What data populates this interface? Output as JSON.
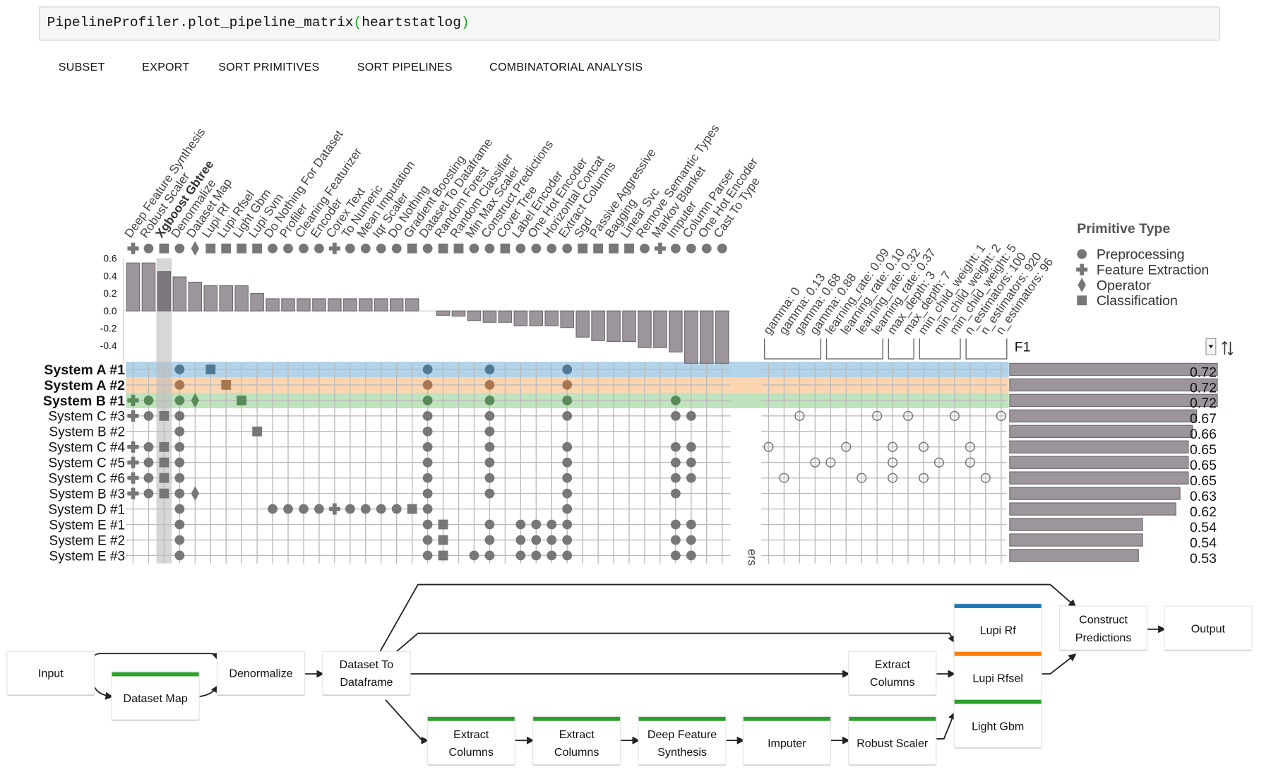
{
  "code_cell": {
    "prefix": "PipelineProfiler.plot_pipeline_matrix",
    "open": "(",
    "arg": "heartstatlog",
    "close": ")"
  },
  "menu": [
    "SUBSET",
    "EXPORT",
    "SORT PRIMITIVES",
    "SORT PIPELINES",
    "COMBINATORIAL ANALYSIS"
  ],
  "colors": {
    "preprocessing_icon": "#777777",
    "bar_fill": "#9c969c",
    "highlight_blue": "#b3d3e8",
    "highlight_orange": "#fdd5b1",
    "highlight_green": "#bfe3bd",
    "node_blue": "#1f77b4",
    "node_orange": "#ff7f0e",
    "node_green": "#2ca02c"
  },
  "legend": {
    "title": "Primitive Type",
    "items": [
      {
        "type": "preprocessing",
        "label": "Preprocessing"
      },
      {
        "type": "feature",
        "label": "Feature Extraction"
      },
      {
        "type": "operator",
        "label": "Operator"
      },
      {
        "type": "classification",
        "label": "Classification"
      }
    ]
  },
  "importance_axis": {
    "ticks": [
      "0.6",
      "0.4",
      "0.2",
      "0.0",
      "-0.2",
      "-0.4"
    ],
    "tick_values": [
      0.6,
      0.4,
      0.2,
      0.0,
      -0.2,
      -0.4
    ],
    "range": [
      -0.6,
      0.6
    ]
  },
  "highlighted_primitive": 2,
  "primitives": [
    {
      "name": "Deep Feature Synthesis",
      "type": "feature",
      "importance": 0.55
    },
    {
      "name": "Robust Scaler",
      "type": "preprocessing",
      "importance": 0.55
    },
    {
      "name": "Xgboost Gbtree",
      "type": "classification",
      "importance": 0.45,
      "bold": true
    },
    {
      "name": "Denormalize",
      "type": "preprocessing",
      "importance": 0.39
    },
    {
      "name": "Dataset Map",
      "type": "operator",
      "importance": 0.33
    },
    {
      "name": "Lupi Rf",
      "type": "classification",
      "importance": 0.29
    },
    {
      "name": "Lupi Rfsel",
      "type": "classification",
      "importance": 0.29
    },
    {
      "name": "Light Gbm",
      "type": "classification",
      "importance": 0.29
    },
    {
      "name": "Lupi Svm",
      "type": "classification",
      "importance": 0.2
    },
    {
      "name": "Do Nothing For Dataset",
      "type": "preprocessing",
      "importance": 0.14
    },
    {
      "name": "Profiler",
      "type": "preprocessing",
      "importance": 0.14
    },
    {
      "name": "Cleaning Featurizer",
      "type": "preprocessing",
      "importance": 0.14
    },
    {
      "name": "Encoder",
      "type": "preprocessing",
      "importance": 0.14
    },
    {
      "name": "Corex Text",
      "type": "feature",
      "importance": 0.14
    },
    {
      "name": "To Numeric",
      "type": "preprocessing",
      "importance": 0.14
    },
    {
      "name": "Mean Imputation",
      "type": "preprocessing",
      "importance": 0.14
    },
    {
      "name": "Iqr Scaler",
      "type": "preprocessing",
      "importance": 0.14
    },
    {
      "name": "Do Nothing",
      "type": "preprocessing",
      "importance": 0.14
    },
    {
      "name": "Gradient Boosting",
      "type": "classification",
      "importance": 0.14
    },
    {
      "name": "Dataset To Dataframe",
      "type": "preprocessing",
      "importance": 0.0
    },
    {
      "name": "Random Forest",
      "type": "classification",
      "importance": -0.05
    },
    {
      "name": "Random Classifier",
      "type": "classification",
      "importance": -0.06
    },
    {
      "name": "Min Max Scaler",
      "type": "preprocessing",
      "importance": -0.11
    },
    {
      "name": "Construct Predictions",
      "type": "preprocessing",
      "importance": -0.13
    },
    {
      "name": "Cover Tree",
      "type": "classification",
      "importance": -0.13
    },
    {
      "name": "Label Encoder",
      "type": "preprocessing",
      "importance": -0.17
    },
    {
      "name": "One Hot Encoder",
      "type": "preprocessing",
      "importance": -0.17
    },
    {
      "name": "Horizontal Concat",
      "type": "preprocessing",
      "importance": -0.17
    },
    {
      "name": "Extract Columns",
      "type": "preprocessing",
      "importance": -0.19
    },
    {
      "name": "Sgd",
      "type": "classification",
      "importance": -0.3
    },
    {
      "name": "Passive Aggressive",
      "type": "classification",
      "importance": -0.34
    },
    {
      "name": "Bagging",
      "type": "classification",
      "importance": -0.35
    },
    {
      "name": "Linear Svc",
      "type": "classification",
      "importance": -0.35
    },
    {
      "name": "Remove Semantic Types",
      "type": "preprocessing",
      "importance": -0.42
    },
    {
      "name": "Markov Blanket",
      "type": "feature",
      "importance": -0.42
    },
    {
      "name": "Imputer",
      "type": "preprocessing",
      "importance": -0.47
    },
    {
      "name": "Column Parser",
      "type": "preprocessing",
      "importance": -0.6
    },
    {
      "name": "One Hot Encoder",
      "type": "preprocessing",
      "importance": -0.6
    },
    {
      "name": "Cast To Type",
      "type": "preprocessing",
      "importance": -0.6
    }
  ],
  "hyperparameters": {
    "labels": [
      "gamma: 0",
      "gamma: 0.13",
      "gamma: 0.68",
      "gamma: 0.88",
      "learning_rate: 0.09",
      "learning_rate: 0.10",
      "learning_rate: 0.32",
      "learning_rate: 0.37",
      "max_depth: 3",
      "max_depth: 7",
      "min_child_weight: 1",
      "min_child_weight: 2",
      "min_child_weight: 5",
      "n_estimators: 100",
      "n_estimators: 920",
      "n_estimators: 96"
    ],
    "groups": [
      [
        0,
        3
      ],
      [
        4,
        7
      ],
      [
        8,
        9
      ],
      [
        10,
        12
      ],
      [
        13,
        15
      ]
    ],
    "side_label": "ers"
  },
  "metric": {
    "label": "F1",
    "range": [
      0.22,
      0.72
    ]
  },
  "pipelines": [
    {
      "name": "System A #1",
      "bold": true,
      "highlight": "blue",
      "primitives": [
        3,
        5,
        19,
        23,
        28
      ],
      "hyper": [],
      "f1": 0.72,
      "f1_label": "0.72"
    },
    {
      "name": "System A #2",
      "bold": true,
      "highlight": "orange",
      "primitives": [
        3,
        6,
        19,
        23,
        28
      ],
      "hyper": [],
      "f1": 0.72,
      "f1_label": "0.72"
    },
    {
      "name": "System B #1",
      "bold": true,
      "highlight": "green",
      "primitives": [
        0,
        1,
        3,
        4,
        7,
        19,
        23,
        28,
        35
      ],
      "hyper": [],
      "f1": 0.72,
      "f1_label": "0.72"
    },
    {
      "name": "System C #3",
      "primitives": [
        0,
        1,
        2,
        3,
        19,
        23,
        28,
        35,
        36
      ],
      "hyper": [
        2,
        7,
        9,
        12,
        15
      ],
      "f1": 0.67,
      "f1_label": "0.67"
    },
    {
      "name": "System B #2",
      "primitives": [
        3,
        8,
        19,
        23
      ],
      "hyper": [],
      "f1": 0.66,
      "f1_label": "0.66"
    },
    {
      "name": "System C #4",
      "primitives": [
        0,
        1,
        2,
        3,
        19,
        23,
        28,
        35,
        36
      ],
      "hyper": [
        0,
        5,
        8,
        10,
        13
      ],
      "f1": 0.65,
      "f1_label": "0.65"
    },
    {
      "name": "System C #5",
      "primitives": [
        0,
        1,
        2,
        3,
        19,
        23,
        28,
        35,
        36
      ],
      "hyper": [
        3,
        4,
        8,
        11,
        13
      ],
      "f1": 0.65,
      "f1_label": "0.65"
    },
    {
      "name": "System C #6",
      "primitives": [
        0,
        1,
        2,
        3,
        19,
        23,
        28,
        35,
        36
      ],
      "hyper": [
        1,
        6,
        8,
        10,
        14
      ],
      "f1": 0.65,
      "f1_label": "0.65"
    },
    {
      "name": "System B #3",
      "primitives": [
        0,
        1,
        2,
        3,
        4,
        19,
        23,
        28,
        35
      ],
      "hyper": [],
      "f1": 0.63,
      "f1_label": "0.63"
    },
    {
      "name": "System D #1",
      "primitives": [
        3,
        9,
        10,
        11,
        12,
        13,
        14,
        15,
        16,
        17,
        18,
        19,
        28
      ],
      "hyper": [],
      "f1": 0.62,
      "f1_label": "0.62"
    },
    {
      "name": "System E #1",
      "primitives": [
        3,
        19,
        20,
        23,
        25,
        26,
        27,
        28,
        35,
        36
      ],
      "hyper": [],
      "f1": 0.54,
      "f1_label": "0.54"
    },
    {
      "name": "System E #2",
      "primitives": [
        3,
        19,
        20,
        23,
        25,
        26,
        27,
        28,
        35,
        36
      ],
      "hyper": [],
      "f1": 0.54,
      "f1_label": "0.54"
    },
    {
      "name": "System E #3",
      "primitives": [
        3,
        19,
        20,
        22,
        23,
        25,
        26,
        27,
        28,
        35,
        36
      ],
      "hyper": [],
      "f1": 0.53,
      "f1_label": "0.53"
    }
  ],
  "graph": {
    "nodes": [
      {
        "id": "input",
        "label": "Input"
      },
      {
        "id": "dataset-map",
        "label": "Dataset Map",
        "bar": "green"
      },
      {
        "id": "denormalize",
        "label": "Denormalize"
      },
      {
        "id": "dataset-to-dataframe",
        "label": "Dataset To Dataframe"
      },
      {
        "id": "extract-columns-top",
        "label": "Extract Columns"
      },
      {
        "id": "extract-columns-1",
        "label": "Extract Columns",
        "bar": "green"
      },
      {
        "id": "extract-columns-2",
        "label": "Extract Columns",
        "bar": "green"
      },
      {
        "id": "deep-feature-synthesis",
        "label": "Deep Feature Synthesis",
        "bar": "green"
      },
      {
        "id": "imputer",
        "label": "Imputer",
        "bar": "green"
      },
      {
        "id": "robust-scaler",
        "label": "Robust Scaler",
        "bar": "green"
      },
      {
        "id": "lupi-rf",
        "label": "Lupi Rf",
        "bar": "blue"
      },
      {
        "id": "lupi-rfsel",
        "label": "Lupi Rfsel",
        "bar": "orange"
      },
      {
        "id": "light-gbm",
        "label": "Light Gbm",
        "bar": "green"
      },
      {
        "id": "construct-predictions",
        "label": "Construct Predictions"
      },
      {
        "id": "output",
        "label": "Output"
      }
    ]
  }
}
